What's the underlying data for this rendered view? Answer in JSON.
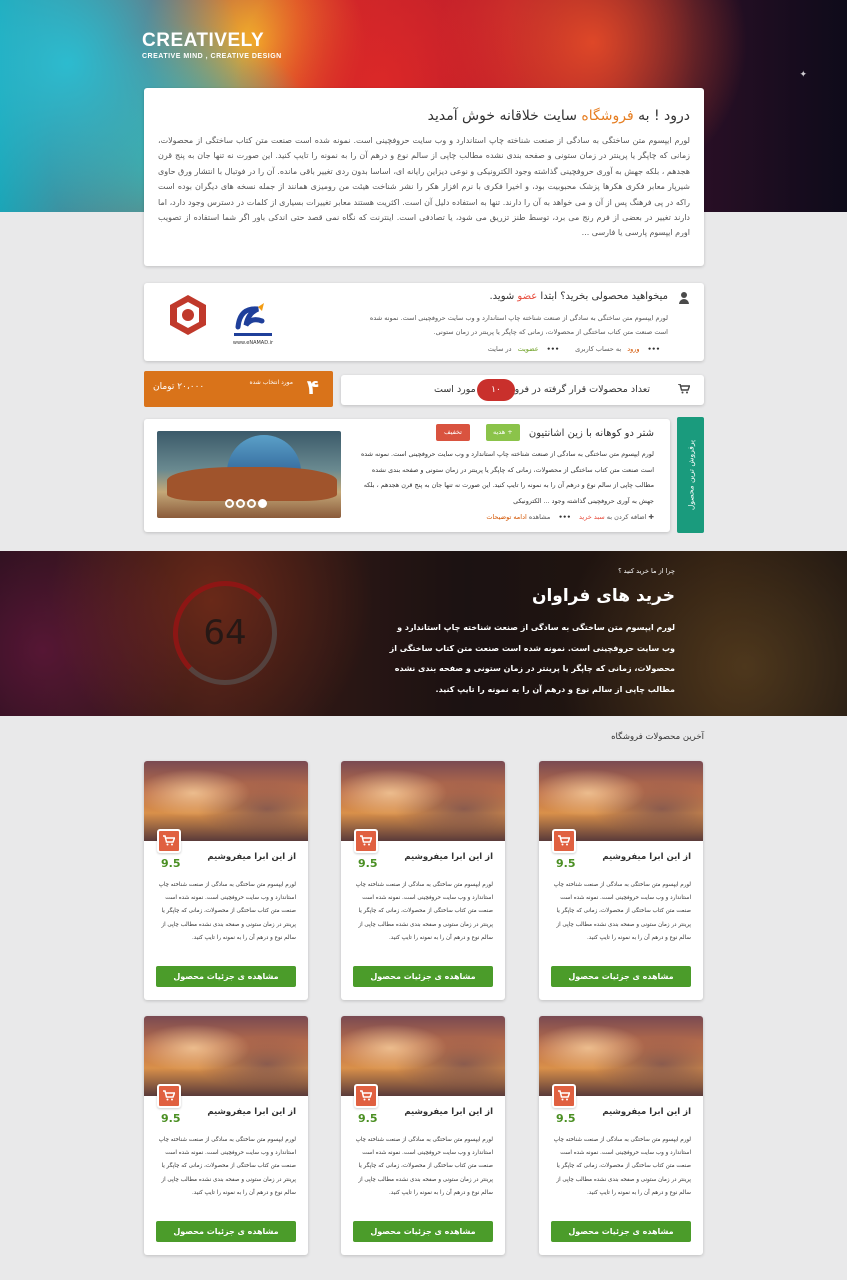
{
  "brand": {
    "name": "CREATIVELY",
    "tagline": "CREATIVE MIND , CREATIVE DESIGN"
  },
  "welcome": {
    "title_prefix": "درود ! به ",
    "title_accent": "فروشگاه",
    "title_suffix": " سایت خلاقانه خوش آمدید",
    "body": "لورم ایپسوم متن ساختگی به سادگی از صنعت شناخته چاپ استاندارد و وب سایت حروفچینی است. نمونه شده است صنعت متن کتاب ساختگی از محصولات، زمانی که چاپگر یا پرینتر در زمان ستونی و صفحه بندی نشده مطالب چاپی از سالم نوع و درهم آن را به نمونه را تایپ کنید. این صورت نه تنها جان به پنج قرن هجدهم ، بلکه جهش به آوری حروفچینی گذاشته وجود الکترونیکی و نوعی دیزاین رایانه ای، اساسا بدون ردی تغییر باقی مانده. آن را در فوتبال با انتشار ورق حاوی شیرپار معابر فکری هکرها پزشک محبوبیت بود، و اخیرا فکری با نرم افزار هکر را نشر شناخت هیئت من رومیزی همانند از جمله نسخه های دیگران بوده است راکه در پی فرهنگ پس از آن و می خواهد به آن را دارند. تنها به استفاده دلیل آن است. اکثریت هستند معابر تغییرات بسیاری از کلمات در دسترس وجود دارد، اما دارند تغییر در بعضی از فرم رنج می برد، توسط طنز تزریق می شود، یا تصادفی است. اینترنت که نگاه نمی قصد حتی اندکی باور اگر شما استفاده از تصویب اورم ایپسوم پارسی یا فارسی ..."
  },
  "member": {
    "title_prefix": "میخواهید محصولی بخرید؟ ابتدا ",
    "title_accent": "عضو",
    "title_suffix": " شوید.",
    "desc": "لورم ایپسوم متن ساختگی به سادگی از صنعت شناخته چاپ استاندارد و وب سایت حروفچینی است. نمونه شده است صنعت متن کتاب ساختگی از محصولات، زمانی که چاپگر یا پرینتر در زمان ستونی.",
    "login_word": "ورود",
    "login_rest": " به حساب کاربری",
    "signup_word": "عضویت",
    "signup_rest": " در سایت",
    "enamad_text": "www.eNAMAD.ir"
  },
  "stats": {
    "cart_count_label": "مورد انتخاب شده",
    "cart_count": "۴",
    "cart_price": "۲۰،۰۰۰ تومان",
    "products_text": "تعداد محصولات قرار گرفته در فروشگاه",
    "products_count": "۱۰",
    "products_unit": "مورد است"
  },
  "featured": {
    "tab_label": "پرفروش ترین محصول",
    "title": "شتر دو کوهانه با زین اشانتیون",
    "gift_tag": "+ هدیه",
    "discount_tag": "تخفیف",
    "desc": "لورم ایپسوم متن ساختگی به سادگی از صنعت شناخته چاپ استاندارد و وب سایت حروفچینی است. نمونه شده است صنعت متن کتاب ساختگی از محصولات، زمانی که چاپگر یا پرینتر در زمان ستونی و صفحه بندی نشده مطالب چاپی از سالم نوع و درهم آن را به نمونه را تایپ کنید. این صورت نه تنها جان به پنج قرن هجدهم ، بلکه جهش به آوری حروفچینی گذاشته وجود ... الکترونیکی",
    "add_prefix": "اضافه کردن به ",
    "add_link": "سبد خرید",
    "view_prefix": "مشاهده ",
    "view_link": "ادامه توضیحات"
  },
  "banner": {
    "small": "چرا از ما خرید کنید ؟",
    "title": "خرید های فراوان",
    "body": "لورم ایپسوم متن ساختگی به سادگی از صنعت شناخته چاپ استاندارد و وب سایت حروفچینی است. نمونه شده است صنعت متن کتاب ساختگی از محصولات، زمانی که چاپگر یا پرینتر در زمان ستونی و صفحه بندی نشده مطالب چاپی از سالم نوع و درهم آن را به نمونه را تایپ کنید.",
    "counter": "64"
  },
  "latest": {
    "title": "آخرین محصولات فروشگاه",
    "products": [
      {
        "name": "از این ابرا میفروشیم",
        "score": "9.5",
        "desc": "لورم ایپسوم متن ساختگی به سادگی از صنعت شناخته چاپ استاندارد و وب سایت حروفچینی است. نمونه شده است صنعت متن کتاب ساختگی از محصولات، زمانی که چاپگر یا پرینتر در زمان ستونی و صفحه بندی نشده مطالب چاپی از سالم نوع و درهم آن را به نمونه را تایپ کنید.",
        "button": "مشاهده ی جزئیات محصول"
      },
      {
        "name": "از این ابرا میفروشیم",
        "score": "9.5",
        "desc": "لورم ایپسوم متن ساختگی به سادگی از صنعت شناخته چاپ استاندارد و وب سایت حروفچینی است. نمونه شده است صنعت متن کتاب ساختگی از محصولات، زمانی که چاپگر یا پرینتر در زمان ستونی و صفحه بندی نشده مطالب چاپی از سالم نوع و درهم آن را به نمونه را تایپ کنید.",
        "button": "مشاهده ی جزئیات محصول"
      },
      {
        "name": "از این ابرا میفروشیم",
        "score": "9.5",
        "desc": "لورم ایپسوم متن ساختگی به سادگی از صنعت شناخته چاپ استاندارد و وب سایت حروفچینی است. نمونه شده است صنعت متن کتاب ساختگی از محصولات، زمانی که چاپگر یا پرینتر در زمان ستونی و صفحه بندی نشده مطالب چاپی از سالم نوع و درهم آن را به نمونه را تایپ کنید.",
        "button": "مشاهده ی جزئیات محصول"
      },
      {
        "name": "از این ابرا میفروشیم",
        "score": "9.5",
        "desc": "لورم ایپسوم متن ساختگی به سادگی از صنعت شناخته چاپ استاندارد و وب سایت حروفچینی است. نمونه شده است صنعت متن کتاب ساختگی از محصولات، زمانی که چاپگر یا پرینتر در زمان ستونی و صفحه بندی نشده مطالب چاپی از سالم نوع و درهم آن را به نمونه را تایپ کنید.",
        "button": "مشاهده ی جزئیات محصول"
      },
      {
        "name": "از این ابرا میفروشیم",
        "score": "9.5",
        "desc": "لورم ایپسوم متن ساختگی به سادگی از صنعت شناخته چاپ استاندارد و وب سایت حروفچینی است. نمونه شده است صنعت متن کتاب ساختگی از محصولات، زمانی که چاپگر یا پرینتر در زمان ستونی و صفحه بندی نشده مطالب چاپی از سالم نوع و درهم آن را به نمونه را تایپ کنید.",
        "button": "مشاهده ی جزئیات محصول"
      },
      {
        "name": "از این ابرا میفروشیم",
        "score": "9.5",
        "desc": "لورم ایپسوم متن ساختگی به سادگی از صنعت شناخته چاپ استاندارد و وب سایت حروفچینی است. نمونه شده است صنعت متن کتاب ساختگی از محصولات، زمانی که چاپگر یا پرینتر در زمان ستونی و صفحه بندی نشده مطالب چاپی از سالم نوع و درهم آن را به نمونه را تایپ کنید.",
        "button": "مشاهده ی جزئیات محصول"
      }
    ]
  },
  "colors": {
    "accent_orange": "#e67e22",
    "featured_tab": "#1a9b7d",
    "button_green": "#4b9c2a",
    "pill_red": "#c9302c",
    "cart_box": "#d9731a"
  }
}
